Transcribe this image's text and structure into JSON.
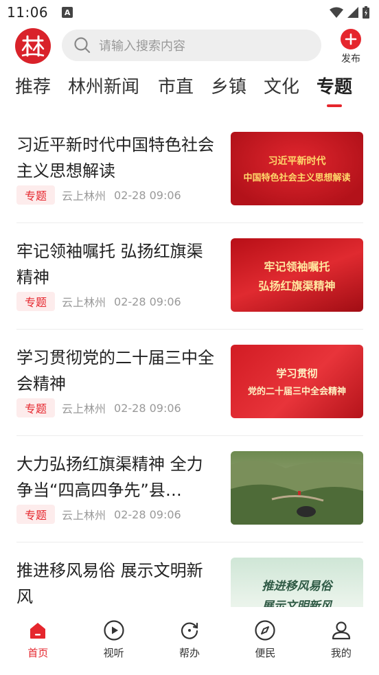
{
  "status": {
    "time": "11:06",
    "notification_icon": "A"
  },
  "header": {
    "search_placeholder": "请输入搜索内容",
    "publish_label": "发布",
    "logo_text": "林"
  },
  "tabs": [
    {
      "label": "推荐"
    },
    {
      "label": "林州新闻"
    },
    {
      "label": "市直"
    },
    {
      "label": "乡镇"
    },
    {
      "label": "文化"
    },
    {
      "label": "专题",
      "active": true
    }
  ],
  "feed": [
    {
      "title": "习近平新时代中国特色社会主义思想解读",
      "tag": "专题",
      "source": "云上林州",
      "time": "02-28 09:06",
      "thumb_line1": "习近平新时代",
      "thumb_line2": "中国特色社会主义思想解读"
    },
    {
      "title": "牢记领袖嘱托 弘扬红旗渠精神",
      "tag": "专题",
      "source": "云上林州",
      "time": "02-28 09:06",
      "thumb_line1": "牢记领袖嘱托",
      "thumb_line2": "弘扬红旗渠精神"
    },
    {
      "title": "学习贯彻党的二十届三中全会精神",
      "tag": "专题",
      "source": "云上林州",
      "time": "02-28 09:06",
      "thumb_line1": "学习贯彻",
      "thumb_line2": "党的二十届三中全会精神"
    },
    {
      "title": "大力弘扬红旗渠精神 全力争当“四高四争先”县…",
      "tag": "专题",
      "source": "云上林州",
      "time": "02-28 09:06",
      "thumb_line1": "",
      "thumb_line2": ""
    },
    {
      "title": "推进移风易俗 展示文明新风",
      "tag": "",
      "source": "",
      "time": "",
      "thumb_line1": "推进移风易俗",
      "thumb_line2": "展示文明新风"
    }
  ],
  "bottom_nav": [
    {
      "label": "首页",
      "icon": "home-icon",
      "active": true
    },
    {
      "label": "视听",
      "icon": "play-icon"
    },
    {
      "label": "帮办",
      "icon": "refresh-icon"
    },
    {
      "label": "便民",
      "icon": "compass-icon"
    },
    {
      "label": "我的",
      "icon": "user-icon"
    }
  ],
  "colors": {
    "accent": "#e5262d",
    "thumb_red": "#c8151d",
    "tag_bg": "#fdecec"
  }
}
